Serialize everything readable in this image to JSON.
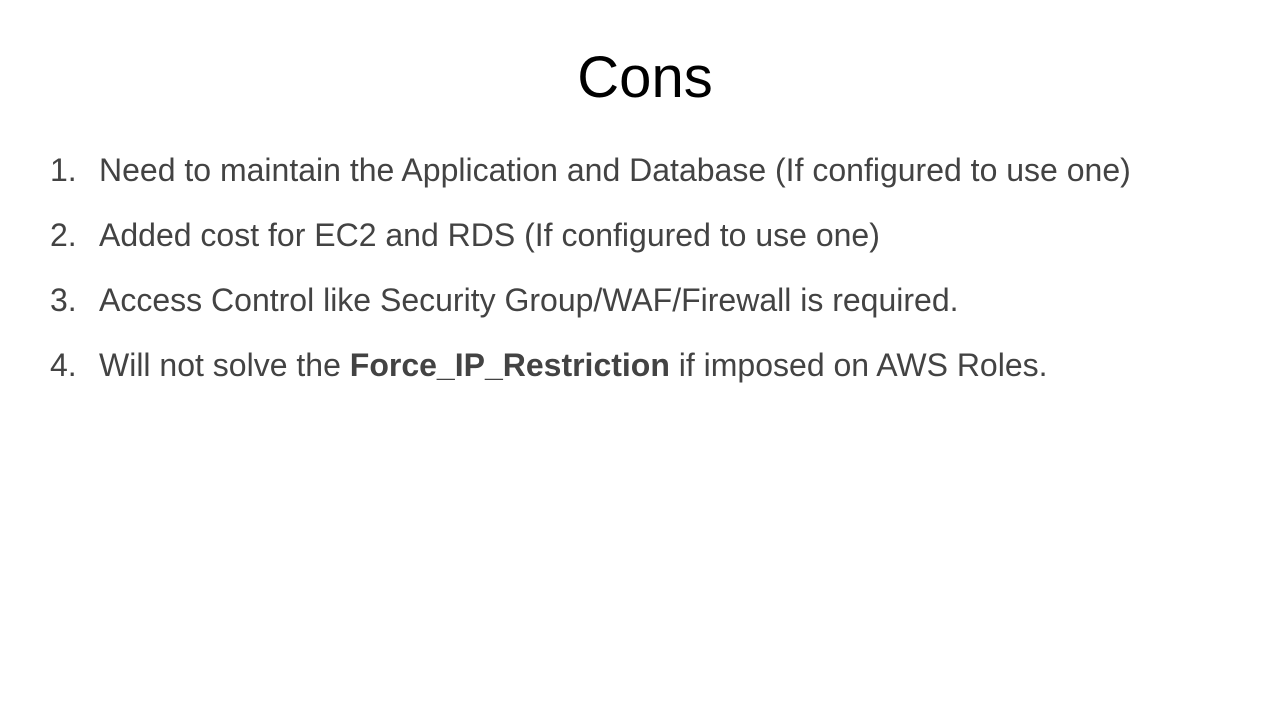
{
  "slide": {
    "title": "Cons",
    "items": [
      {
        "number": "1.",
        "text": "Need to maintain the Application and Database (If configured to use one)"
      },
      {
        "number": "2.",
        "text": "Added cost for EC2 and RDS (If configured to use one)"
      },
      {
        "number": "3.",
        "text": "Access Control like Security Group/WAF/Firewall is required."
      },
      {
        "number": "4.",
        "text_before": "Will not solve the ",
        "text_bold": "Force_IP_Restriction",
        "text_after": " if imposed on AWS Roles."
      }
    ]
  }
}
